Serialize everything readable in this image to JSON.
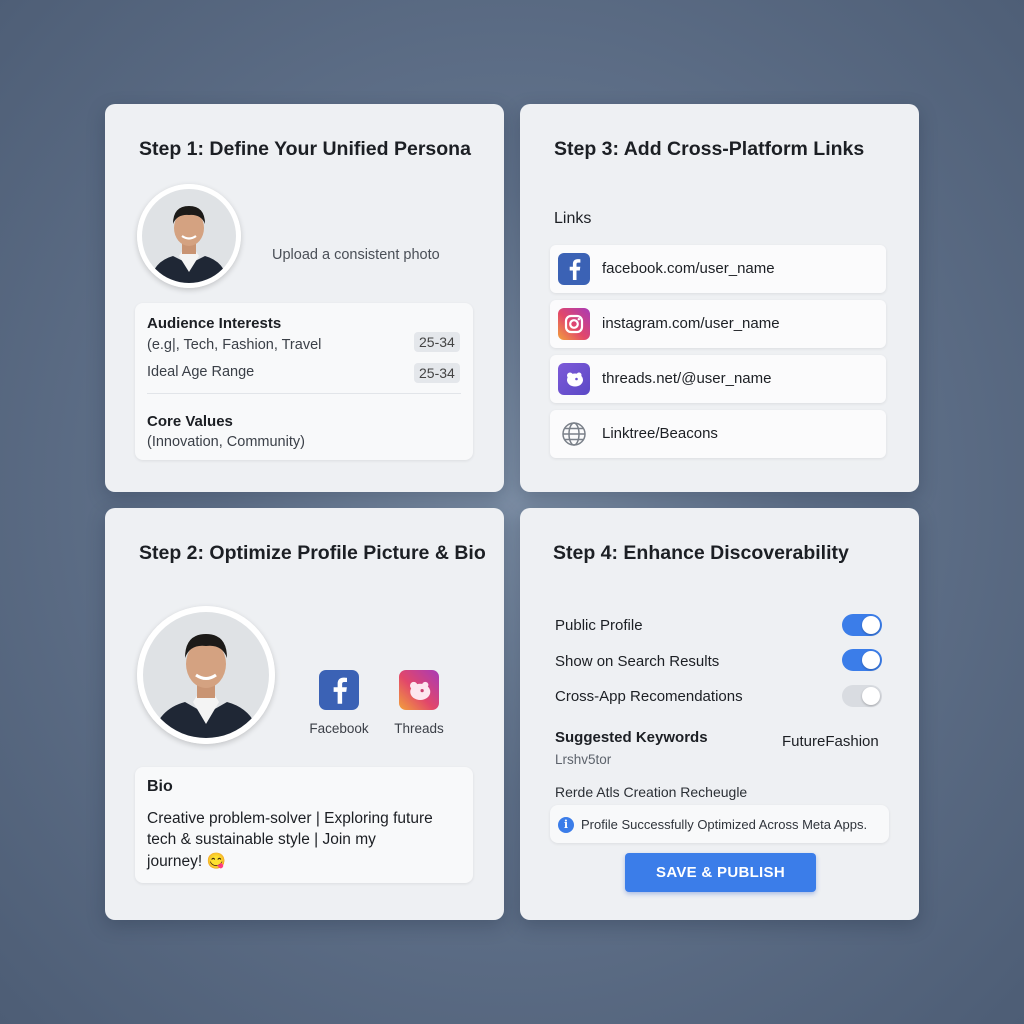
{
  "step1": {
    "title": "Step 1: Define Your Unified Persona",
    "upload_text": "Upload a consistent photo",
    "audience_label": "Audience Interests",
    "audience_value": "(e.g|, Tech, Fashion, Travel",
    "audience_badge": "25-34",
    "age_label": "Ideal Age Range",
    "age_badge": "25-34",
    "values_label": "Core Values",
    "values_value": "(Innovation, Community)"
  },
  "step2": {
    "title": "Step 2: Optimize Profile Picture & Bio",
    "platforms": [
      {
        "name": "Facebook",
        "icon": "facebook-icon",
        "color": "#3b62b5"
      },
      {
        "name": "Threads",
        "icon": "threads-icon",
        "color": "#d2467a"
      }
    ],
    "bio_label": "Bio",
    "bio_line1": "Creative problem-solver | Exploring future",
    "bio_line2": "tech & sustainable style | Join my",
    "bio_line3": "journey! 😋"
  },
  "step3": {
    "title": "Step 3: Add Cross-Platform Links",
    "links_label": "Links",
    "links": [
      {
        "text": "facebook.com/user_name",
        "icon": "facebook-icon"
      },
      {
        "text": "instagram.com/user_name",
        "icon": "instagram-icon"
      },
      {
        "text": "threads.net/@user_name",
        "icon": "threads-icon"
      },
      {
        "text": "Linktree/Beacons",
        "icon": "globe-icon"
      }
    ]
  },
  "step4": {
    "title": "Step 4: Enhance Discoverability",
    "toggles": [
      {
        "label": "Public Profile",
        "on": true
      },
      {
        "label": "Show on Search Results",
        "on": true
      },
      {
        "label": "Cross-App Recomendations",
        "on": false
      }
    ],
    "keywords_label": "Suggested Keywords",
    "keyword_tag": "FutureFashion",
    "keyword_sub": "Lrshv5tor",
    "creation_text": "Rerde Atls Creation Recheugle",
    "info_text": "Profile Successfully Optimized Across Meta Apps.",
    "save_button": "SAVE & PUBLISH"
  },
  "colors": {
    "accent": "#3b7de9",
    "facebook": "#3b62b5",
    "toggle_on": "#3b7de9",
    "toggle_off": "#d9dce1"
  }
}
